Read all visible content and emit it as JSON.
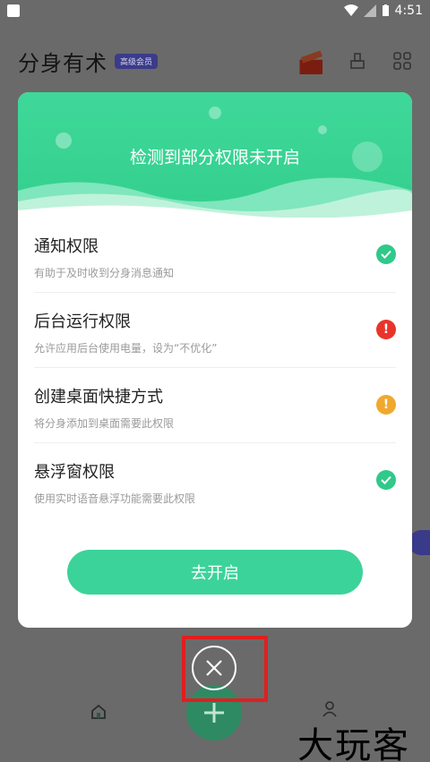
{
  "status_bar": {
    "time": "4:51"
  },
  "app": {
    "title": "分身有术",
    "badge": "高级会员"
  },
  "modal": {
    "title": "检测到部分权限未开启",
    "permissions": [
      {
        "title": "通知权限",
        "desc": "有助于及时收到分身消息通知",
        "status": "granted",
        "status_color": "#2fc98a"
      },
      {
        "title": "后台运行权限",
        "desc": "允许应用后台使用电量，设为“不优化”",
        "status": "error",
        "status_color": "#e8342b"
      },
      {
        "title": "创建桌面快捷方式",
        "desc": "将分身添加到桌面需要此权限",
        "status": "warning",
        "status_color": "#f0a92e"
      },
      {
        "title": "悬浮窗权限",
        "desc": "使用实时语音悬浮功能需要此权限",
        "status": "granted",
        "status_color": "#2fc98a"
      }
    ],
    "open_label": "去开启"
  },
  "close_icon": "close-circle-icon",
  "watermark": "大玩客",
  "colors": {
    "accent": "#3cd39a",
    "highlight": "#e01f1f"
  }
}
